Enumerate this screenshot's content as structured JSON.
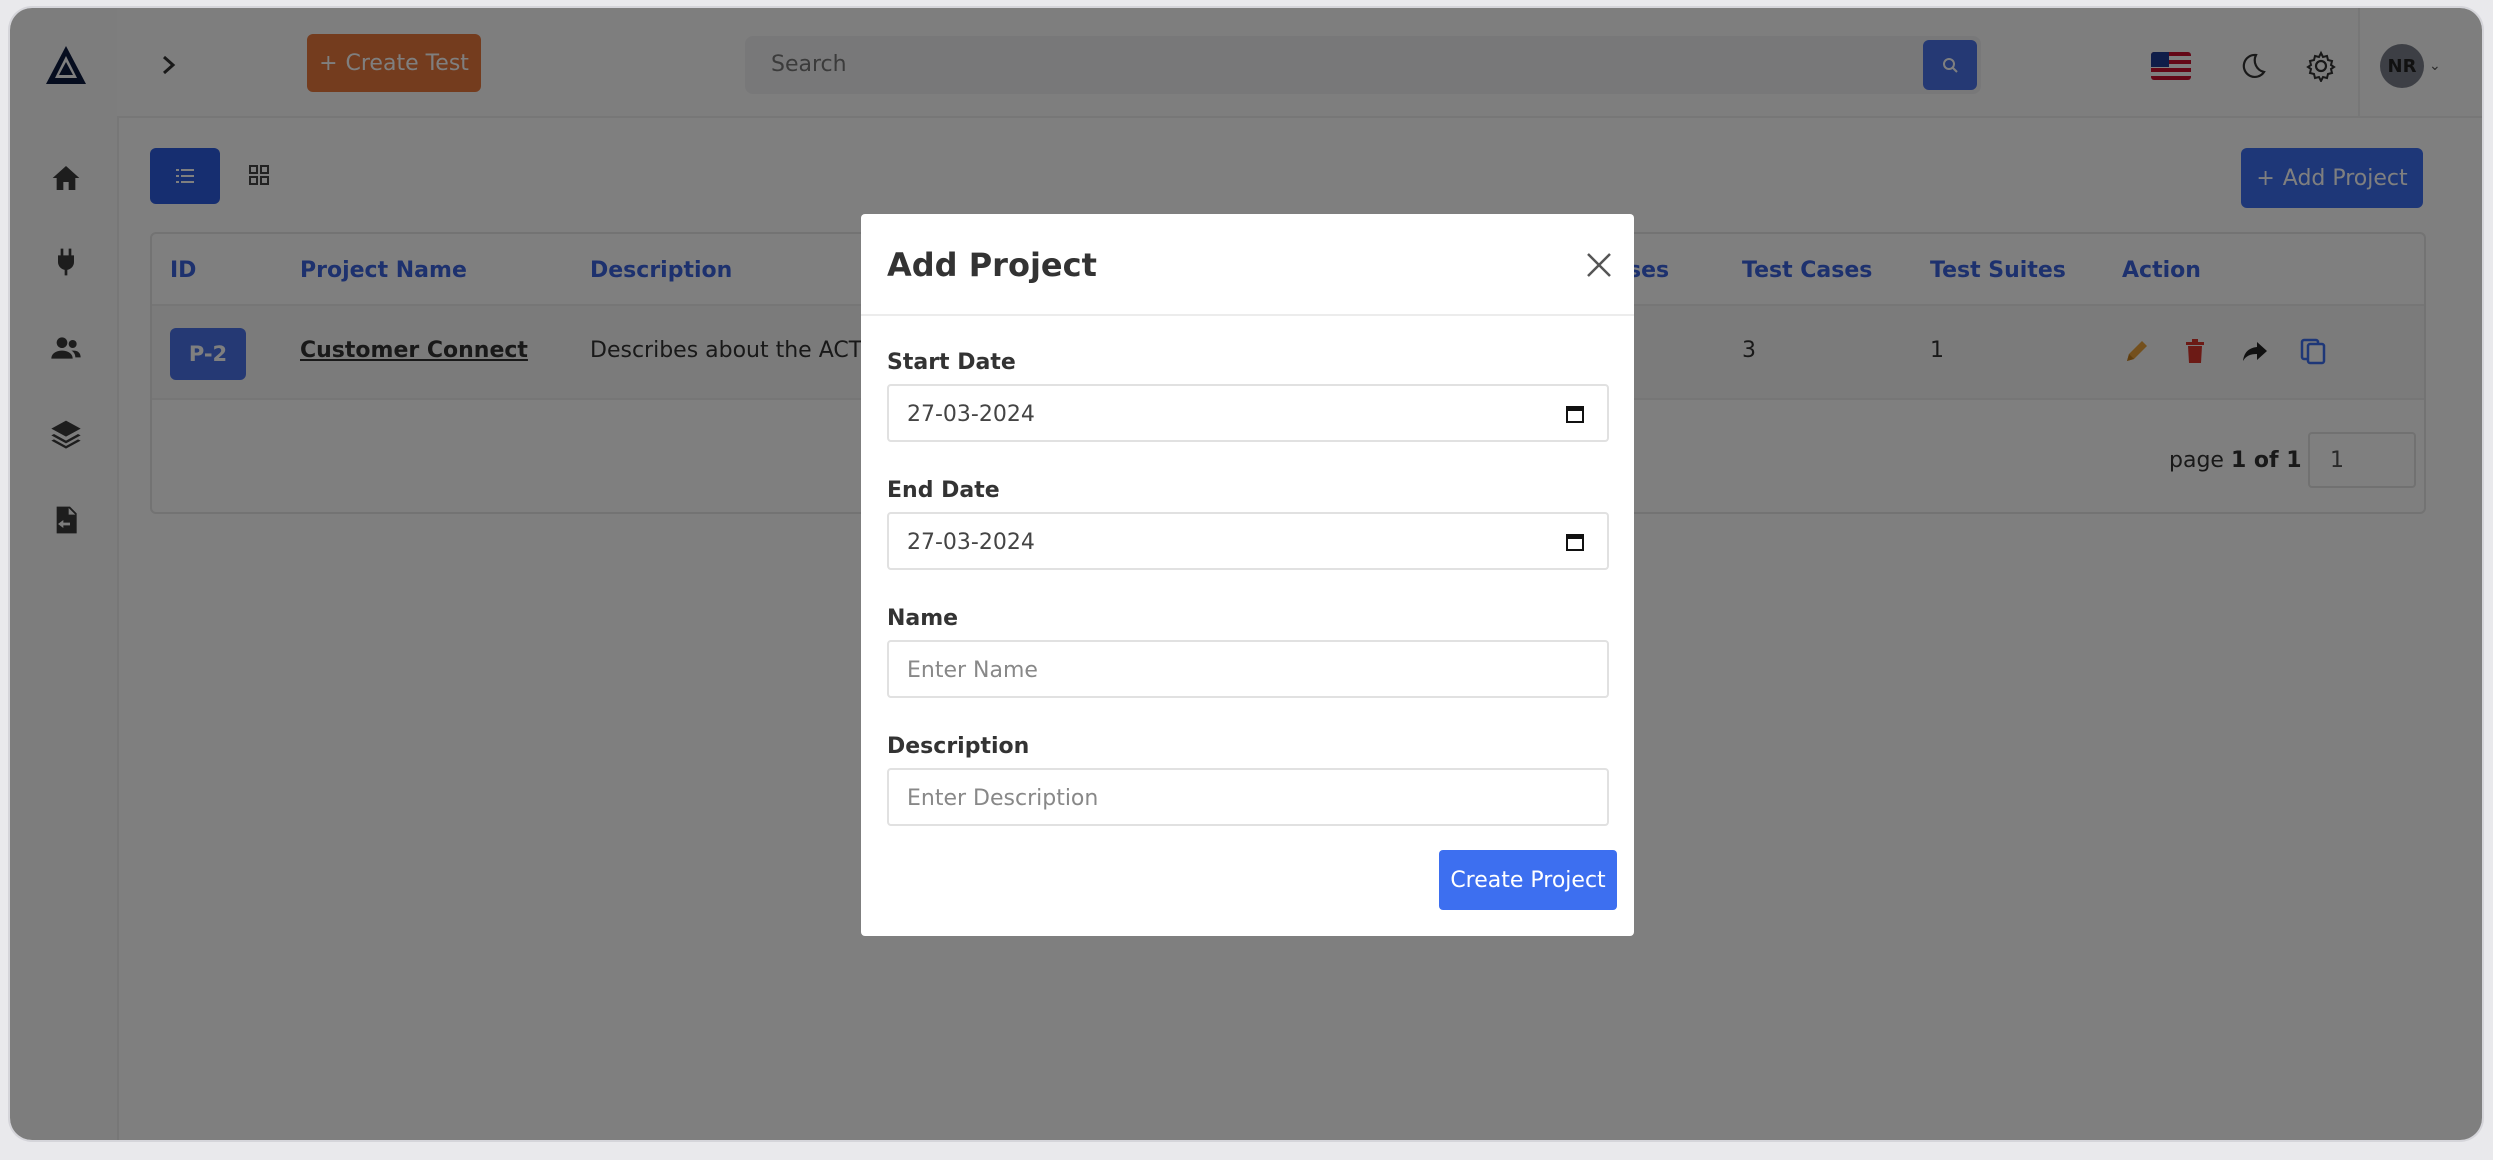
{
  "header": {
    "create_test_label": "Create Test",
    "search_placeholder": "Search",
    "avatar_initials": "NR"
  },
  "toolbar": {
    "add_project_label": "Add Project"
  },
  "table": {
    "columns": [
      "ID",
      "Project Name",
      "Description",
      "ses",
      "Test Cases",
      "Test Suites",
      "Action"
    ],
    "rows": [
      {
        "id": "P-2",
        "name": "Customer Connect",
        "description": "Describes about the ACTS us",
        "test_cases": "3",
        "test_suites": "1"
      }
    ],
    "pager": {
      "prefix": "page ",
      "current": "1",
      "sep": " of ",
      "total": "1",
      "input_value": "1"
    }
  },
  "modal": {
    "title": "Add Project",
    "start_date_label": "Start Date",
    "start_date_value": "27-03-2024",
    "end_date_label": "End Date",
    "end_date_value": "27-03-2024",
    "name_label": "Name",
    "name_placeholder": "Enter Name",
    "description_label": "Description",
    "description_placeholder": "Enter Description",
    "submit_label": "Create Project"
  },
  "colors": {
    "primary": "#3d6ff0",
    "accent_orange": "#e8783d",
    "edit": "#e8a13a",
    "delete": "#d9342b"
  }
}
